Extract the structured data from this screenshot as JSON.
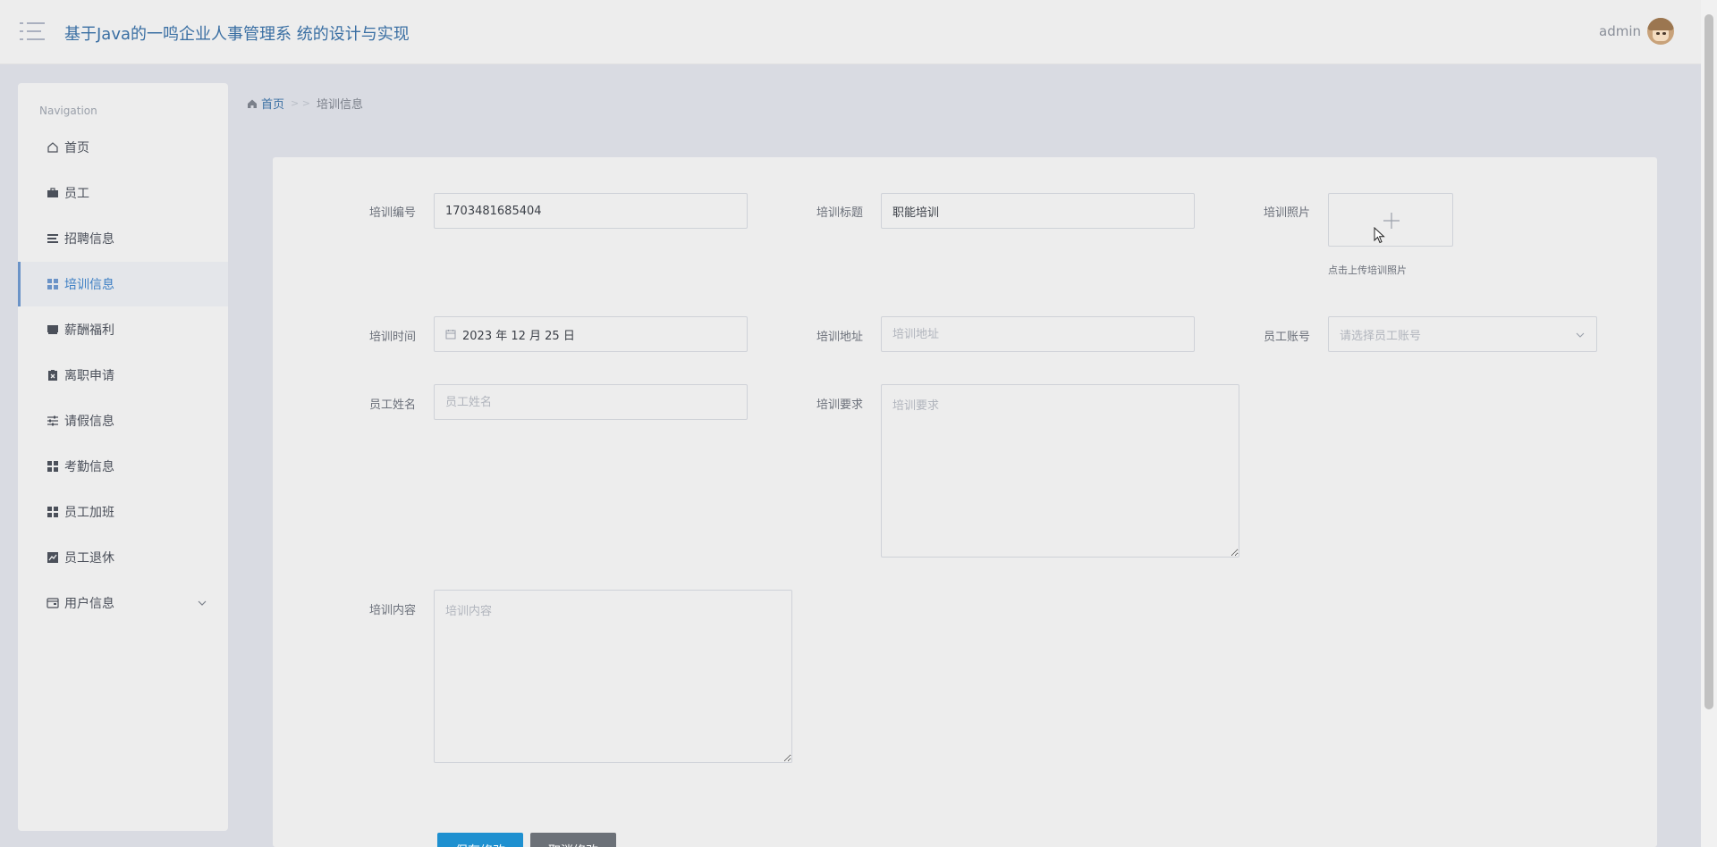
{
  "header": {
    "title": "基于Java的一鸣企业人事管理系 统的设计与实现",
    "user": "admin"
  },
  "sidebar": {
    "heading": "Navigation",
    "items": [
      {
        "label": "首页",
        "icon": "home-icon"
      },
      {
        "label": "员工",
        "icon": "briefcase-icon"
      },
      {
        "label": "招聘信息",
        "icon": "list-icon"
      },
      {
        "label": "培训信息",
        "icon": "grid-icon",
        "active": true
      },
      {
        "label": "薪酬福利",
        "icon": "inbox-icon"
      },
      {
        "label": "离职申请",
        "icon": "clipboard-icon"
      },
      {
        "label": "请假信息",
        "icon": "sliders-icon"
      },
      {
        "label": "考勤信息",
        "icon": "grid-icon"
      },
      {
        "label": "员工加班",
        "icon": "grid-icon"
      },
      {
        "label": "员工退休",
        "icon": "chart-icon"
      },
      {
        "label": "用户信息",
        "icon": "wallet-icon",
        "has_children": true
      }
    ]
  },
  "breadcrumb": {
    "home": "首页",
    "separator": "> >",
    "current": "培训信息"
  },
  "form": {
    "code": {
      "label": "培训编号",
      "value": "1703481685404"
    },
    "title": {
      "label": "培训标题",
      "value": "职能培训"
    },
    "photo": {
      "label": "培训照片",
      "hint": "点击上传培训照片"
    },
    "time": {
      "label": "培训时间",
      "value": "2023 年 12 月 25 日"
    },
    "address": {
      "label": "培训地址",
      "placeholder": "培训地址"
    },
    "account": {
      "label": "员工账号",
      "placeholder": "请选择员工账号"
    },
    "name": {
      "label": "员工姓名",
      "placeholder": "员工姓名"
    },
    "requirement": {
      "label": "培训要求",
      "placeholder": "培训要求"
    },
    "content": {
      "label": "培训内容",
      "placeholder": "培训内容"
    }
  },
  "actions": {
    "save": "保存修改",
    "cancel": "取消修改"
  },
  "colors": {
    "primary": "#1e90d0",
    "cancel": "#6c7178",
    "title": "#3a6fa3"
  }
}
